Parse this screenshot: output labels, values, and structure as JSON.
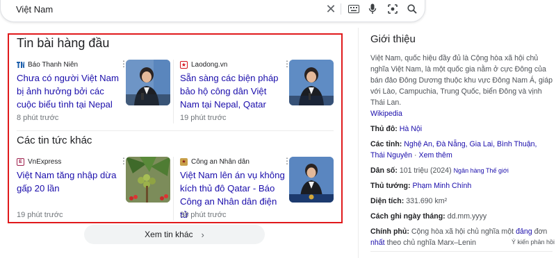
{
  "search": {
    "query": "Việt Nam"
  },
  "news": {
    "top_title": "Tin bài hàng đầu",
    "other_title": "Các tin tức khác",
    "cards": [
      {
        "source": "Báo Thanh Niên",
        "headline": "Chưa có người Việt Nam bị ảnh hưởng bởi các cuộc biểu tình tại Nepal",
        "time": "8 phút trước"
      },
      {
        "source": "Laodong.vn",
        "headline": "Sẵn sàng các biện pháp bảo hộ công dân Việt Nam tại Nepal, Qatar",
        "time": "19 phút trước"
      },
      {
        "source": "VnExpress",
        "headline": "Việt Nam tăng nhập dừa gấp 20 lần",
        "time": "19 phút trước"
      },
      {
        "source": "Công an Nhân dân",
        "headline": "Việt Nam lên án vụ không kích thủ đô Qatar - Báo Công an Nhân dân điện tử",
        "time": "38 phút trước"
      }
    ],
    "more_label": "Xem tin khác"
  },
  "panel": {
    "title": "Giới thiệu",
    "description": "Việt Nam, quốc hiệu đầy đủ là Cộng hòa xã hội chủ nghĩa Việt Nam, là một quốc gia nằm ở cực Đông của bán đảo Đông Dương thuộc khu vực Đông Nam Á, giáp với Lào, Campuchia, Trung Quốc, biển Đông và vịnh Thái Lan.",
    "wiki_link": "Wikipedia",
    "capital_label": "Thủ đô:",
    "capital_value": "Hà Nội",
    "provinces_label": "Các tỉnh:",
    "provinces_value": "Nghệ An, Đà Nẵng, Gia Lai, Bình Thuận, Thái Nguyên",
    "provinces_more": "Xem thêm",
    "population_label": "Dân số:",
    "population_value": "101 triệu (2024)",
    "population_source": "Ngân hàng Thế giới",
    "pm_label": "Thủ tướng:",
    "pm_value": "Phạm Minh Chính",
    "area_label": "Diện tích:",
    "area_value": "331.690 km²",
    "date_label": "Cách ghi ngày tháng:",
    "date_value": "dd.mm.yyyy",
    "gov_label": "Chính phủ:",
    "gov_text1": "Cộng hòa xã hội chủ nghĩa một",
    "gov_link1": "đảng",
    "gov_text2": "đơn",
    "gov_link2": "nhất",
    "gov_text3": "theo chủ nghĩa Marx–Lenin",
    "feedback": "Ý kiến phản hồi"
  }
}
